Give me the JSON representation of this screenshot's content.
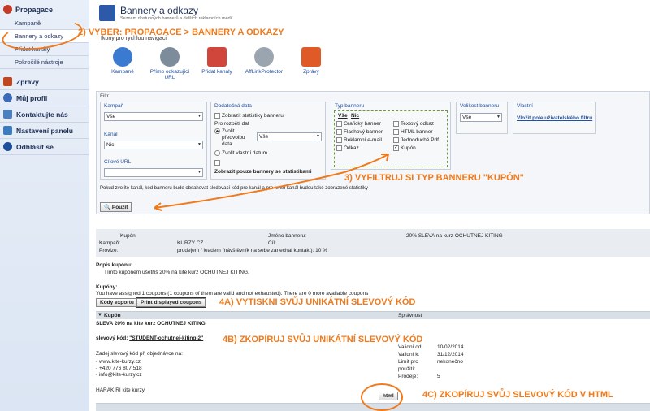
{
  "sidebar": {
    "header": "Propagace",
    "subitems": [
      {
        "label": "Kampaně"
      },
      {
        "label": "Bannery a odkazy"
      },
      {
        "label": "Přidat kanály"
      },
      {
        "label": "Pokročilé nástroje"
      }
    ],
    "main": [
      {
        "label": "Zprávy",
        "color": "#c1461e"
      },
      {
        "label": "Můj profil",
        "color": "#3a6bb8"
      },
      {
        "label": "Kontaktujte nás",
        "color": "#4a7fc0"
      },
      {
        "label": "Nastavení panelu",
        "color": "#3a7cbf"
      },
      {
        "label": "Odhlásit se",
        "color": "#1d4f9a"
      }
    ]
  },
  "page": {
    "title": "Bannery a odkazy",
    "subtitle": "Seznam dostupných bannerů a dalších reklamních médií",
    "quicknav_title": "Ikony pro rychlou navigaci"
  },
  "quicknav": [
    {
      "label": "Kampaně",
      "color": "#3a7ad0"
    },
    {
      "label": "Přímo odkazující URL",
      "color": "#7d8c9a"
    },
    {
      "label": "Přidat kanály",
      "color": "#d1463b"
    },
    {
      "label": "AffLinkProtector",
      "color": "#9aa5b0"
    },
    {
      "label": "Zprávy",
      "color": "#e05a28"
    }
  ],
  "filter": {
    "title": "Filtr",
    "kampan_label": "Kampaň",
    "kampan_value": "Vše",
    "kanal_label": "Kanál",
    "kanal_value": "Nic",
    "url_label": "Cílové URL",
    "url_value": "",
    "extra_label": "Dodatečná data",
    "extra_stats": "Zobrazit statistiky banneru",
    "extra_period": "Pro rozpětí dat",
    "extra_choose1": "Zvolit",
    "extra_choose2": "předvolbu",
    "extra_choose3": "data",
    "extra_period_value": "Vše",
    "extra_custom": "Zvolit vlastní datum",
    "extra_only_stats": "Zobrazit pouze bannery se statistikami",
    "type_label": "Typ banneru",
    "type_all": "Vše",
    "type_none": "Nic",
    "types": [
      "Grafický banner",
      "Flashový banner",
      "Reklamní e-mail",
      "Odkaz",
      "Textový odkaz",
      "HTML banner",
      "Jednoduché Pdf",
      "Kupón"
    ],
    "size_label": "Velikost banneru",
    "size_value": "Vše",
    "custom_label": "Vlastní",
    "custom_link": "Vložit pole uživatelského filtru",
    "note": "Pokud zvolíte kanál, kód banneru bude obsahovat sledovací kód pro kanál a pro tento kanál budou také zobrazené statistiky",
    "apply": "Použít"
  },
  "banner": {
    "type_label": "Kupón",
    "name_label": "Jméno banneru:",
    "name_value": "20% SLEVA na kurz OCHUTNEJ KITING",
    "campaign_label": "Kampaň:",
    "campaign_value": "KURZY CZ",
    "target_label": "Cíl:",
    "commission_label": "Provize:",
    "commission_value": "prodejem / leadem (návštěvník na sebe zanechal kontakt): 10 %",
    "desc_label": "Popis kupónu:",
    "desc_value": "Tímto kupónem ušetříš 20% na kite kurz OCHUTNEJ KITING.",
    "coupons_label": "Kupóny:",
    "coupons_info": "You have assigned 1 coupons (1 coupons of them are valid and not exhausted). There are 0 more available coupons",
    "export_btn": "Kódy exportu",
    "print_btn": "Print displayed coupons",
    "col_coupon": "Kupón",
    "col_manage": "Správnost",
    "coupon_title": "SLEVA 20% na kite kurz OCHUTNEJ KITING",
    "code_label": "slevový kód:",
    "code_value": "\"STUDENT-ochutnej-kiting-2\"",
    "enter_text": "Zadej slevový kód při objednávce na:",
    "contacts": [
      "- www.kite-kurzy.cz",
      "- +420 776 807 518",
      "- info@kite-kurzy.cz"
    ],
    "sign": "HARAKIRI kite kurzy",
    "valid_from_label": "Validní od:",
    "valid_from": "10/02/2014",
    "valid_to_label": "Validní k:",
    "valid_to": "31/12/2014",
    "limit_label": "Limit pro",
    "limit_label2": "použití:",
    "limit_value": "nekonečno",
    "sales_label": "Prodeje:",
    "sales_value": "5",
    "html_btn": "html"
  },
  "annotations": {
    "a2": "2) VYBER: PROPAGACE > BANNERY A ODKAZY",
    "a3": "3) VYFILTRUJ SI TYP BANNERU \"KUPÓN\"",
    "a4a": "4A) VYTISKNI SVŮJ UNIKÁTNÍ SLEVOVÝ KÓD",
    "a4b": "4B) ZKOPÍRUJ SVŮJ UNIKÁTNÍ SLEVOVÝ KÓD",
    "a4c": "4C) ZKOPÍRUJ SVŮJ SLEVOVÝ KÓD V HTML",
    "color": "#f07a1b"
  }
}
